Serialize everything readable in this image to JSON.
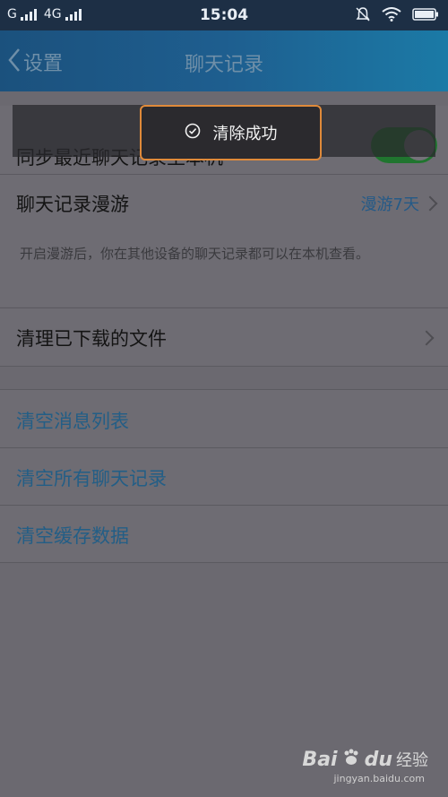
{
  "status_bar": {
    "carrier1": "G",
    "carrier2": "4G",
    "time": "15:04",
    "icons": [
      "signal-icon",
      "signal-icon",
      "mute-bell-icon",
      "wifi-icon",
      "battery-icon"
    ]
  },
  "nav": {
    "back_label": "设置",
    "title": "聊天记录"
  },
  "settings": {
    "sync_label": "同步最近聊天记录至本机",
    "sync_on": true,
    "roaming_label": "聊天记录漫游",
    "roaming_value": "漫游7天",
    "roaming_desc": "开启漫游后，你在其他设备的聊天记录都可以在本机查看。",
    "downloaded_label": "清理已下载的文件",
    "clear_list": "清空消息列表",
    "clear_all": "清空所有聊天记录",
    "clear_cache": "清空缓存数据"
  },
  "toast": {
    "text": "清除成功"
  },
  "watermark": {
    "brand": "Bai",
    "brand_suffix": "du",
    "jingyan": "经验",
    "url": "jingyan.baidu.com"
  },
  "colors": {
    "overlay": "#6b6970",
    "link_blue": "#235e86",
    "toggle_green": "#20752f",
    "toast_border": "#e08a3a"
  }
}
